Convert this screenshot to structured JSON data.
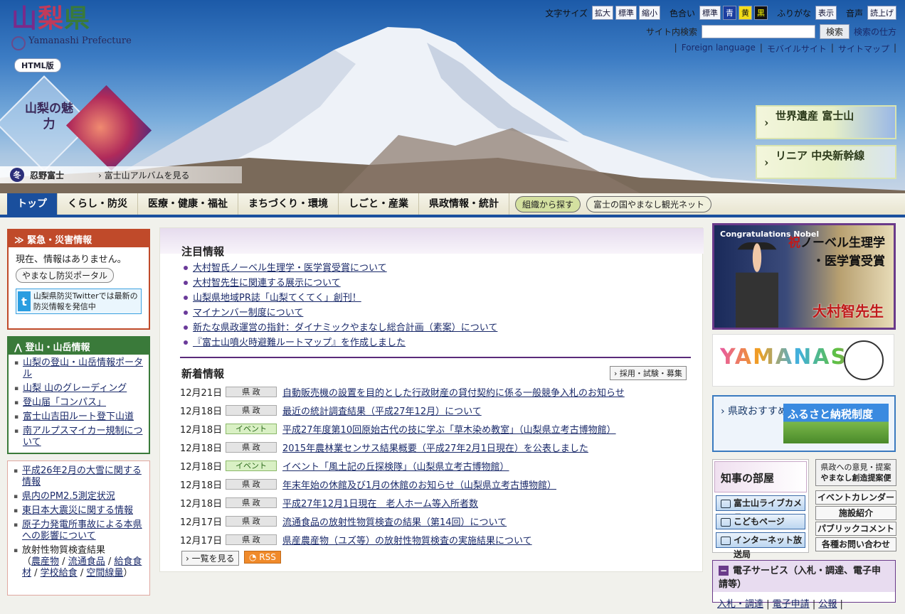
{
  "header": {
    "logo_kanji": [
      "山",
      "梨",
      "県"
    ],
    "logo_en": "Yamanashi Prefecture",
    "html_version": "HTML版",
    "toolbar": {
      "font_size_label": "文字サイズ",
      "font_size_options": [
        "拡大",
        "標準",
        "縮小"
      ],
      "color_label": "色合い",
      "color_options": [
        "標準",
        "青",
        "黄",
        "黒"
      ],
      "furigana_label": "ふりがな",
      "furigana_button": "表示",
      "voice_label": "音声",
      "voice_button": "読上げ"
    },
    "search": {
      "label": "サイト内検索",
      "placeholder": "",
      "button": "検索",
      "help": "検索の仕方"
    },
    "links": [
      "Foreign language",
      "モバイルサイト",
      "サイトマップ"
    ],
    "miryoku": "山梨の魅力",
    "season_badge": "冬",
    "photo_place": "忍野富士",
    "album_link": "富士山アルバムを見る",
    "banners": [
      "世界遺産 富士山",
      "リニア 中央新幹線"
    ]
  },
  "nav": {
    "items": [
      "トップ",
      "くらし・防災",
      "医療・健康・福祉",
      "まちづくり・環境",
      "しごと・産業",
      "県政情報・統計"
    ],
    "pills": [
      "組織から探す",
      "富士の国やまなし観光ネット"
    ]
  },
  "emergency": {
    "title": "緊急・災害情報",
    "status": "現在、情報はありません。",
    "portal": "やまなし防災ポータル",
    "twitter": "山梨県防災Twitterでは最新の防災情報を発信中"
  },
  "mountain": {
    "title": "登山・山岳情報",
    "items": [
      "山梨の登山・山岳情報ポータル",
      "山梨 山のグレーディング",
      "登山届「コンパス」",
      "富士山吉田ルート登下山道",
      "南アルプスマイカー規制について"
    ]
  },
  "misc": {
    "items": [
      "平成26年2月の大雪に関する情報",
      "県内のPM2.5測定状況",
      "東日本大震災に関する情報",
      "原子力発電所事故による本県への影響について"
    ],
    "radiation_label": "放射性物質検査結果",
    "radiation_links": [
      "農産物",
      "流通食品",
      "給食食材",
      "学校給食",
      "空間線量"
    ]
  },
  "featured": {
    "title": "注目情報",
    "items": [
      "大村智氏ノーベル生理学・医学賞受賞について",
      "大村智先生に関連する展示について",
      "山梨県地域PR誌「山梨てくてく」創刊！",
      "マイナンバー制度について",
      "新たな県政運営の指針：ダイナミックやまなし総合計画（素案）について",
      "『富士山噴火時避難ルートマップ』を作成しました"
    ]
  },
  "news": {
    "title": "新着情報",
    "recruit": "採用・試験・募集",
    "rows": [
      {
        "date": "12月21日",
        "tag": "県 政",
        "text": "自動販売機の設置を目的とした行政財産の貸付契約に係る一般競争入札のお知らせ"
      },
      {
        "date": "12月18日",
        "tag": "県 政",
        "text": "最近の統計調査結果（平成27年12月）について"
      },
      {
        "date": "12月18日",
        "tag": "イベント",
        "text": "平成27年度第10回原始古代の技に学ぶ「草木染め教室」（山梨県立考古博物館）"
      },
      {
        "date": "12月18日",
        "tag": "県 政",
        "text": "2015年農林業センサス結果概要（平成27年2月1日現在）を公表しました"
      },
      {
        "date": "12月18日",
        "tag": "イベント",
        "text": "イベント「風土記の丘探検隊」（山梨県立考古博物館）"
      },
      {
        "date": "12月18日",
        "tag": "県 政",
        "text": "年末年始の休館及び1月の休館のお知らせ（山梨県立考古博物館）"
      },
      {
        "date": "12月18日",
        "tag": "県 政",
        "text": "平成27年12月1日現在　老人ホーム等入所者数"
      },
      {
        "date": "12月17日",
        "tag": "県 政",
        "text": "流通食品の放射性物質検査の結果（第14回）について"
      },
      {
        "date": "12月17日",
        "tag": "県 政",
        "text": "県産農産物（ユズ等）の放射性物質検査の実施結果について"
      }
    ],
    "list_link": "一覧を見る",
    "rss": "RSS"
  },
  "right": {
    "nobel_en": "Congratulations Nobel",
    "nobel_line1": "祝",
    "nobel_line1b": "ノーベル生理学",
    "nobel_line2": "・医学賞受賞",
    "nobel_name": "大村智先生",
    "kitty": "YAMANASHI",
    "osusume": "県政おすすめサイト",
    "furusato": "ふるさと納税制度",
    "chiji": "知事の部屋",
    "chiji_links": [
      "富士山ライブカメラ",
      "こどもページ",
      "インターネット放送局"
    ],
    "teian_small": "県政への意見・提案",
    "teian": "やまなし創造提案便",
    "right_links": [
      "イベントカレンダー",
      "施設紹介",
      "パブリックコメント",
      "各種お問い合わせ"
    ],
    "denshi_title": "電子サービス（入札・調達、電子申請等）",
    "denshi_links": [
      "入札・調達",
      "電子申請",
      "公報"
    ]
  }
}
